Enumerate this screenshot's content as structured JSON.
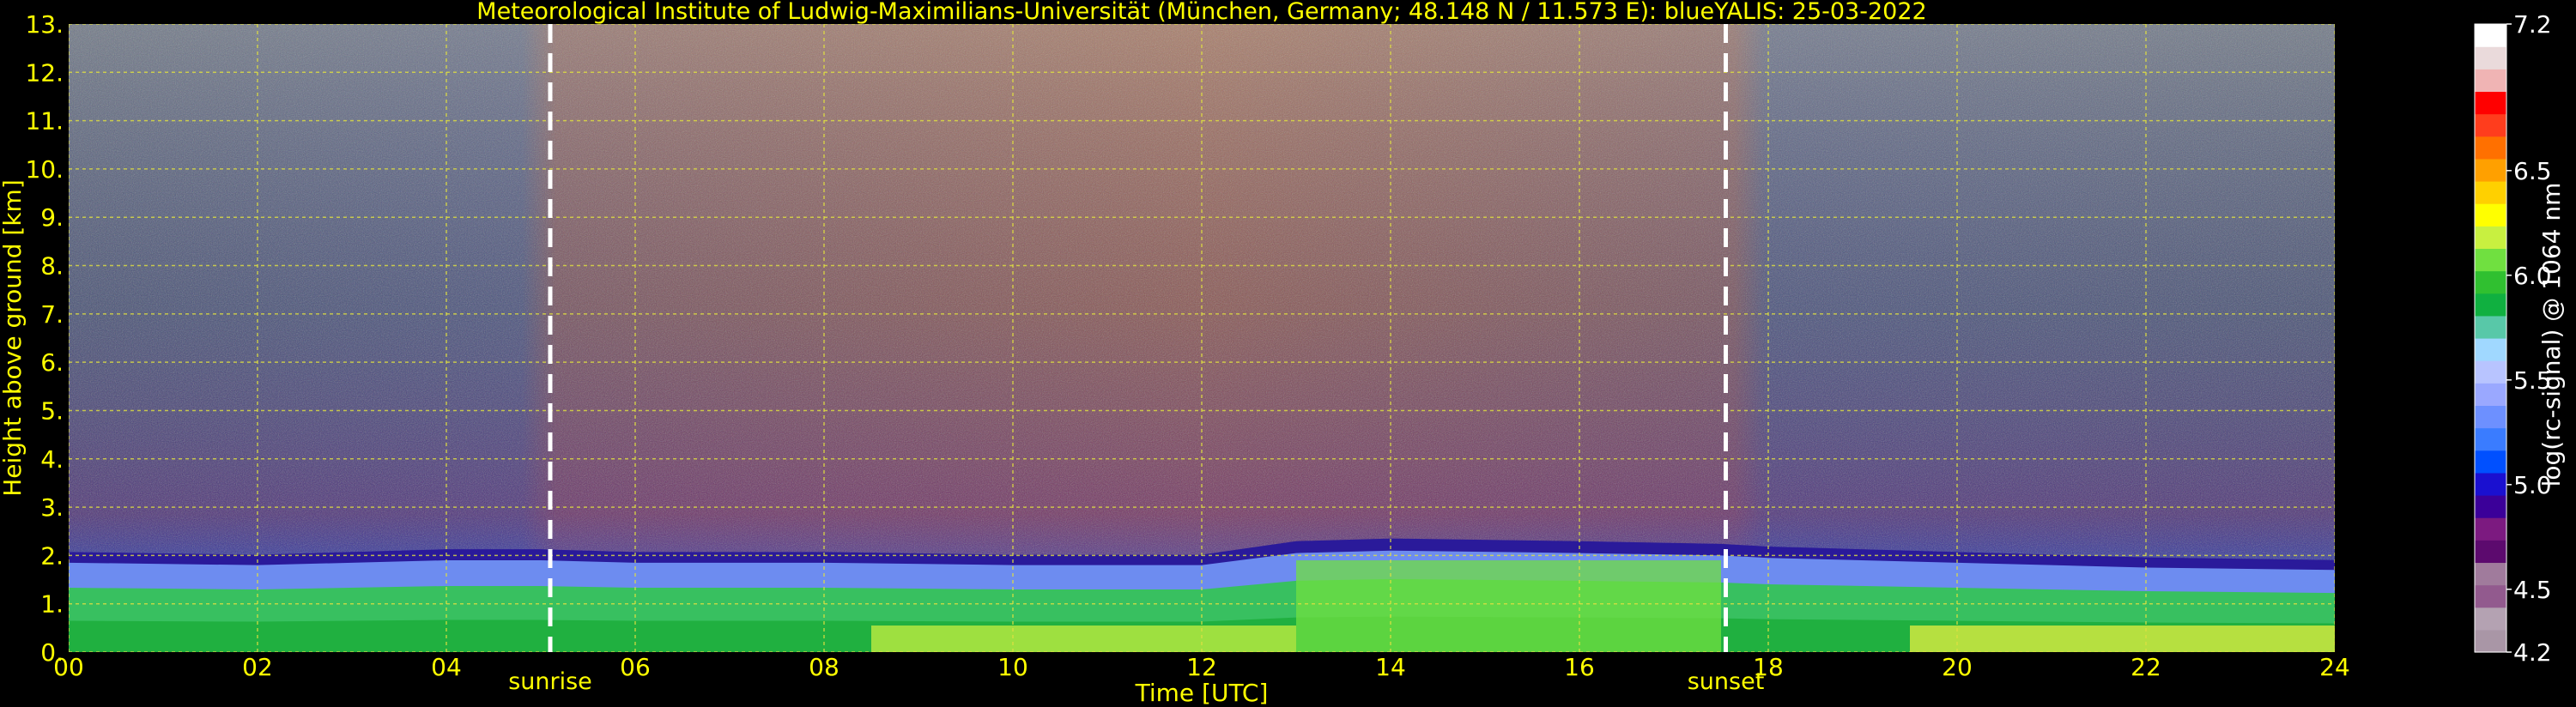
{
  "chart_data": {
    "type": "heatmap",
    "title": "Meteorological Institute of Ludwig-Maximilians-Universität (München, Germany; 48.148 N / 11.573 E):    blueYALIS: 25-03-2022",
    "xlabel": "Time [UTC]",
    "ylabel": "Height above ground [km]",
    "xlim": [
      0,
      24
    ],
    "ylim": [
      0,
      13
    ],
    "x_ticks": [
      "00",
      "02",
      "04",
      "06",
      "08",
      "10",
      "12",
      "14",
      "16",
      "18",
      "20",
      "22",
      "24"
    ],
    "y_ticks": [
      "0.",
      "1.",
      "2.",
      "3.",
      "4.",
      "5.",
      "6.",
      "7.",
      "8.",
      "9.",
      "10.",
      "11.",
      "12.",
      "13."
    ],
    "grid": true,
    "annotations": [
      {
        "label": "sunrise",
        "x": 5.1
      },
      {
        "label": "sunset",
        "x": 17.55
      }
    ],
    "colorbar": {
      "label": "log(rc-signal) @ 1064 nm",
      "range": [
        4.2,
        7.2
      ],
      "ticks": [
        "4.2",
        "4.5",
        "5.0",
        "5.5",
        "6.0",
        "6.5",
        "7.2"
      ],
      "colors": [
        "#a996a6",
        "#b4a2b2",
        "#925a8e",
        "#a07b9c",
        "#5c0a6e",
        "#7c1a80",
        "#3b0099",
        "#1a10d0",
        "#0050ff",
        "#3a7cff",
        "#6d90ff",
        "#9aa8ff",
        "#b8c4ff",
        "#a0d8ff",
        "#58c8a8",
        "#10b040",
        "#30c030",
        "#70e040",
        "#c8f040",
        "#ffff00",
        "#ffd000",
        "#ffa000",
        "#ff7000",
        "#ff3d1d",
        "#ff0000",
        "#f0b4b4",
        "#eadadb",
        "#ffffff"
      ]
    },
    "boundary_layer_top_km": {
      "time": [
        0,
        2,
        4,
        5,
        6,
        8,
        10,
        12,
        13,
        14,
        16,
        17.5,
        18,
        20,
        22,
        24
      ],
      "height": [
        1.85,
        1.8,
        1.9,
        1.9,
        1.85,
        1.85,
        1.8,
        1.8,
        2.05,
        2.1,
        2.05,
        2.0,
        1.95,
        1.85,
        1.75,
        1.7
      ]
    }
  }
}
